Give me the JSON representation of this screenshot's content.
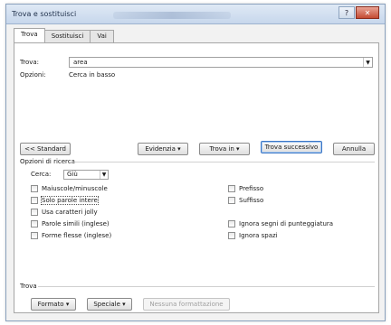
{
  "window": {
    "title": "Trova e sostituisci"
  },
  "tabs": [
    "Trova",
    "Sostituisci",
    "Vai"
  ],
  "find": {
    "label": "Trova:",
    "value": "area",
    "options_label": "Opzioni:",
    "options_value": "Cerca in basso"
  },
  "buttons": {
    "less": "<< Standard",
    "highlight": "Evidenzia ▾",
    "find_in": "Trova in ▾",
    "find_next": "Trova successivo",
    "cancel": "Annulla"
  },
  "search_options": {
    "heading": "Opzioni di ricerca",
    "search_label": "Cerca:",
    "search_value": "Giù",
    "left": [
      "Maiuscole/minuscole",
      "Solo parole intere",
      "Usa caratteri jolly",
      "Parole simili (inglese)",
      "Forme flesse (inglese)"
    ],
    "right": [
      "Prefisso",
      "Suffisso",
      "Ignora segni di punteggiatura",
      "Ignora spazi"
    ]
  },
  "bottom": {
    "heading": "Trova",
    "format": "Formato ▾",
    "special": "Speciale ▾",
    "no_format": "Nessuna formattazione"
  }
}
